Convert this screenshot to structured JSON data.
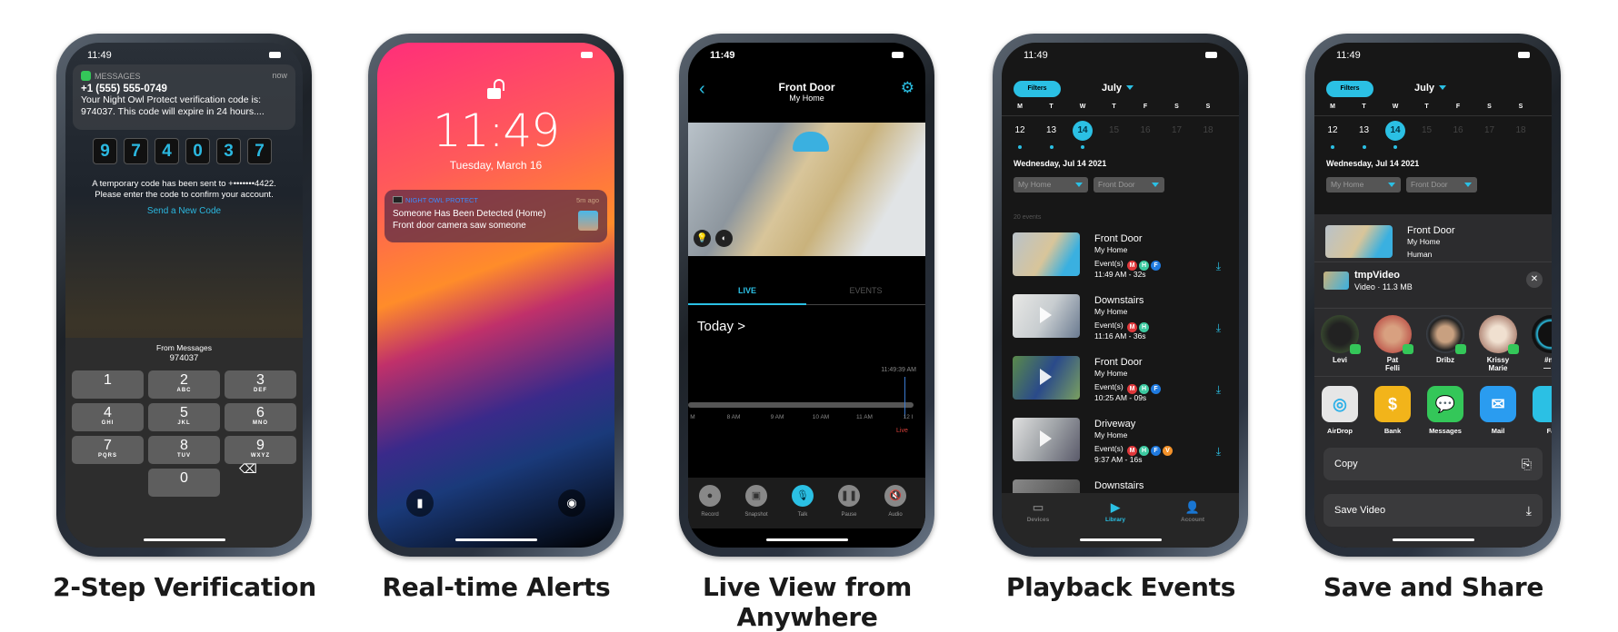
{
  "captions": [
    "2-Step Verification",
    "Real-time Alerts",
    "Live View from Anywhere",
    "Playback Events",
    "Save and Share"
  ],
  "status_time": "11:49",
  "colors": {
    "accent": "#2bc0e4",
    "messages_green": "#34c759",
    "badge_m": "#e0383b",
    "badge_h": "#3cc9a0",
    "badge_f": "#1f7ae0",
    "badge_v": "#f2912a",
    "live_red": "#d8403a"
  },
  "verification": {
    "notification": {
      "app": "MESSAGES",
      "time": "now",
      "sender": "+1 (555) 555-0749",
      "body": "Your Night Owl Protect verification code is: 974037. This code will expire in 24 hours...."
    },
    "code_digits": [
      "9",
      "7",
      "4",
      "0",
      "3",
      "7"
    ],
    "info_line1": "A temporary code has been sent to +•••••••4422.",
    "info_line2": "Please enter the code to confirm your account.",
    "resend_label": "Send a New Code",
    "suggestion_title": "From Messages",
    "suggestion_code": "974037",
    "keys": [
      {
        "n": "1",
        "l": ""
      },
      {
        "n": "2",
        "l": "ABC"
      },
      {
        "n": "3",
        "l": "DEF"
      },
      {
        "n": "4",
        "l": "GHI"
      },
      {
        "n": "5",
        "l": "JKL"
      },
      {
        "n": "6",
        "l": "MNO"
      },
      {
        "n": "7",
        "l": "PQRS"
      },
      {
        "n": "8",
        "l": "TUV"
      },
      {
        "n": "9",
        "l": "WXYZ"
      },
      {
        "n": "0",
        "l": ""
      }
    ],
    "delete_icon": "backspace-icon"
  },
  "alerts": {
    "time": "11:49",
    "date": "Tuesday, March 16",
    "notification": {
      "app": "NIGHT OWL PROTECT",
      "time": "5m ago",
      "title": "Someone Has Been Detected (Home)",
      "body": "Front door camera saw someone"
    },
    "left_icon": "flashlight-icon",
    "right_icon": "camera-icon"
  },
  "live": {
    "title": "Front Door",
    "subtitle": "My Home",
    "tabs": [
      "LIVE",
      "EVENTS"
    ],
    "active_tab": "LIVE",
    "day_link": "Today >",
    "current_time": "11:49:39 AM",
    "timeline_ticks": [
      "M",
      "8 AM",
      "9 AM",
      "10 AM",
      "11 AM",
      "12 I"
    ],
    "live_label": "Live",
    "toolbar": [
      "Record",
      "Snapshot",
      "Talk",
      "Pause",
      "Audio"
    ],
    "active_tool": "Talk"
  },
  "library": {
    "filters_label": "Filters",
    "month": "July",
    "weekdays": [
      "M",
      "T",
      "W",
      "T",
      "F",
      "S",
      "S"
    ],
    "dates": [
      {
        "d": "12",
        "events": true
      },
      {
        "d": "13",
        "events": true
      },
      {
        "d": "14",
        "events": true,
        "selected": true
      },
      {
        "d": "15",
        "events": false
      },
      {
        "d": "16",
        "events": false
      },
      {
        "d": "17",
        "events": false
      },
      {
        "d": "18",
        "events": false
      }
    ],
    "date_title": "Wednesday, Jul 14 2021",
    "location_select": "My Home",
    "camera_select": "Front Door",
    "event_count": "20 events",
    "events": [
      {
        "camera": "Front Door",
        "site": "My Home",
        "label": "Event(s)",
        "badges": [
          "M",
          "H",
          "F"
        ],
        "time": "11:49 AM - 32s"
      },
      {
        "camera": "Downstairs",
        "site": "My Home",
        "label": "Event(s)",
        "badges": [
          "M",
          "H"
        ],
        "time": "11:16 AM - 36s"
      },
      {
        "camera": "Front Door",
        "site": "My Home",
        "label": "Event(s)",
        "badges": [
          "M",
          "H",
          "F"
        ],
        "time": "10:25 AM - 09s"
      },
      {
        "camera": "Driveway",
        "site": "My Home",
        "label": "Event(s)",
        "badges": [
          "M",
          "H",
          "F",
          "V"
        ],
        "time": "9:37 AM - 16s"
      },
      {
        "camera": "Downstairs",
        "site": "",
        "label": "",
        "badges": [],
        "time": ""
      }
    ],
    "tabs": [
      {
        "label": "Devices",
        "icon": "camera-device-icon"
      },
      {
        "label": "Library",
        "icon": "play-icon",
        "active": true
      },
      {
        "label": "Account",
        "icon": "person-icon"
      }
    ]
  },
  "share": {
    "event": {
      "camera": "Front Door",
      "site": "My Home",
      "type": "Human"
    },
    "file_name": "tmpVideo",
    "file_meta": "Video · 11.3 MB",
    "contacts": [
      [
        "Levi",
        ""
      ],
      [
        "Pat",
        "Felli"
      ],
      [
        "Dribz",
        ""
      ],
      [
        "Krissy",
        "Marie"
      ],
      [
        "#ne",
        "— C"
      ]
    ],
    "apps": [
      {
        "label": "AirDrop",
        "icon": "airdrop-icon"
      },
      {
        "label": "Bank",
        "icon": "bank-icon"
      },
      {
        "label": "Messages",
        "icon": "messages-icon"
      },
      {
        "label": "Mail",
        "icon": "mail-icon"
      },
      {
        "label": "Fa",
        "icon": "app-icon"
      }
    ],
    "actions": [
      {
        "label": "Copy",
        "icon": "copy-icon"
      },
      {
        "label": "Save Video",
        "icon": "save-icon"
      }
    ]
  }
}
